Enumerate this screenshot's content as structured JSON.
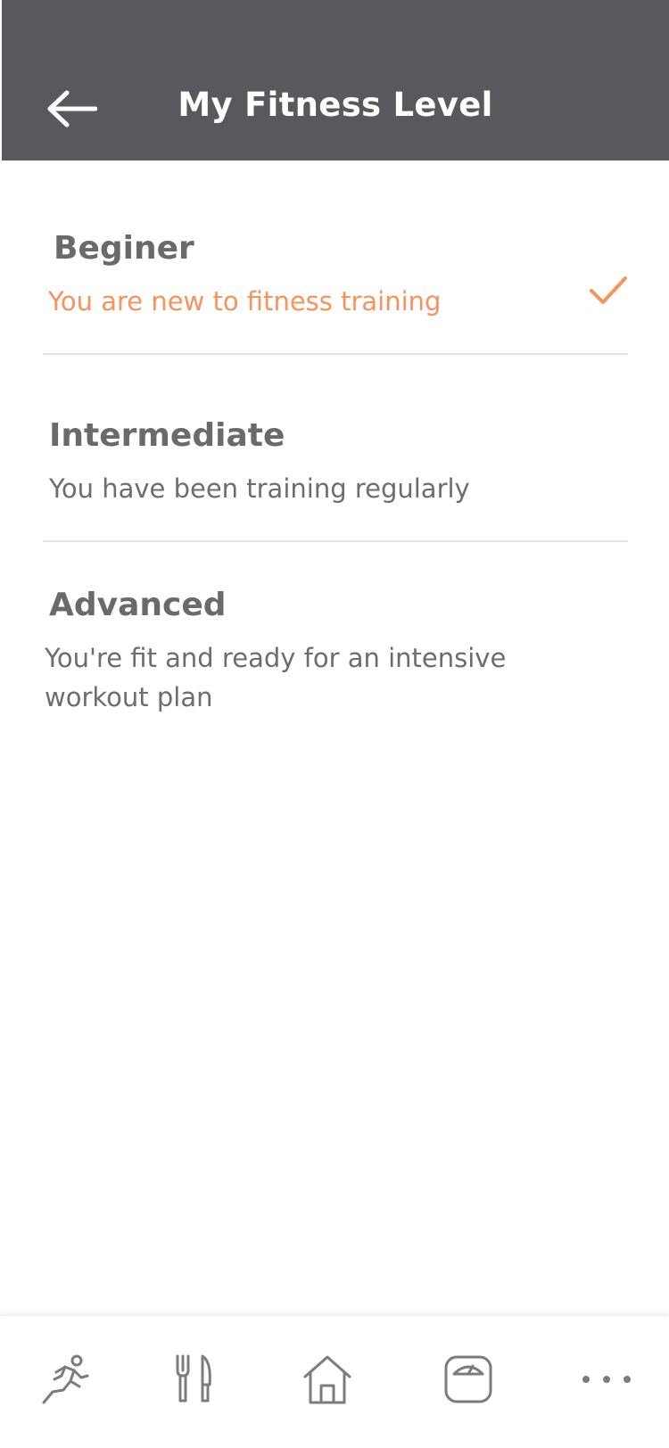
{
  "header": {
    "title": "My Fitness Level",
    "back_icon": "arrow-left-icon"
  },
  "levels": [
    {
      "name": "Beginer",
      "description": "You are new to fitness training",
      "selected": true
    },
    {
      "name": "Intermediate",
      "description": "You have been training regularly",
      "selected": false
    },
    {
      "name": "Advanced",
      "description": "You're fit and ready for an intensive workout plan",
      "selected": false
    }
  ],
  "colors": {
    "header_bg": "#58595c",
    "accent": "#f7935b",
    "text": "#6b6b6b",
    "divider": "#e4e4e4"
  },
  "bottom_nav": [
    {
      "icon": "running-icon"
    },
    {
      "icon": "fork-knife-icon"
    },
    {
      "icon": "home-icon"
    },
    {
      "icon": "scale-icon"
    },
    {
      "icon": "more-icon"
    }
  ]
}
